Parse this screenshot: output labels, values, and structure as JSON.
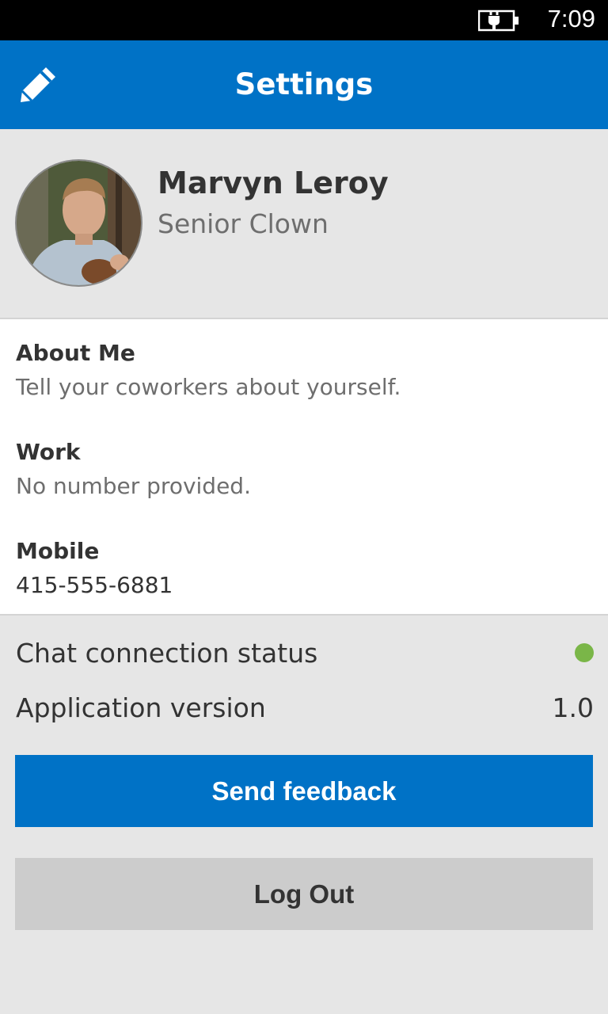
{
  "status_bar": {
    "time": "7:09",
    "battery_icon": "battery-charging-icon"
  },
  "header": {
    "title": "Settings",
    "edit_icon": "pencil-icon",
    "color": "#0072c6"
  },
  "profile": {
    "name": "Marvyn Leroy",
    "title": "Senior Clown",
    "avatar_icon": "profile-photo"
  },
  "details": {
    "about_label": "About Me",
    "about_value": "Tell your coworkers about yourself.",
    "work_label": "Work",
    "work_value": "No number provided.",
    "mobile_label": "Mobile",
    "mobile_value": "415-555-6881"
  },
  "info": {
    "chat_status_label": "Chat connection status",
    "chat_status_color": "#7ab648",
    "version_label": "Application version",
    "version_value": "1.0"
  },
  "buttons": {
    "send_feedback": "Send feedback",
    "log_out": "Log Out"
  }
}
